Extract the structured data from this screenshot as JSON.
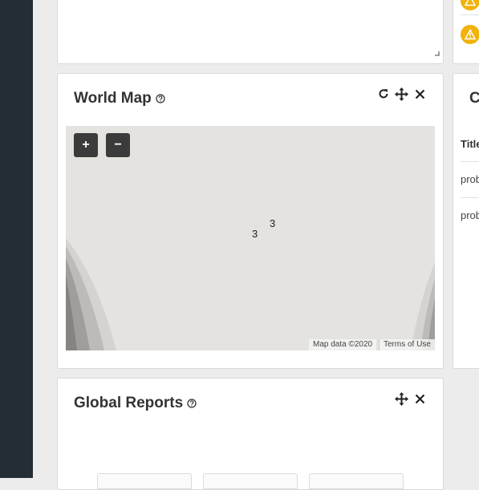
{
  "world_map": {
    "title": "World Map",
    "zoom_in_label": "+",
    "zoom_out_label": "−",
    "clusters": [
      "3",
      "3"
    ],
    "attribution": "Map data ©2020",
    "terms": "Terms of Use"
  },
  "global_reports": {
    "title": "Global Reports"
  },
  "right_panel": {
    "title_fragment": "C",
    "table_header": "Title",
    "rows": [
      "prob",
      "prob"
    ]
  },
  "colors": {
    "sidebar": "#232d33",
    "warning": "#f1b20b",
    "map_zoom_button": "#3b3b3b"
  }
}
